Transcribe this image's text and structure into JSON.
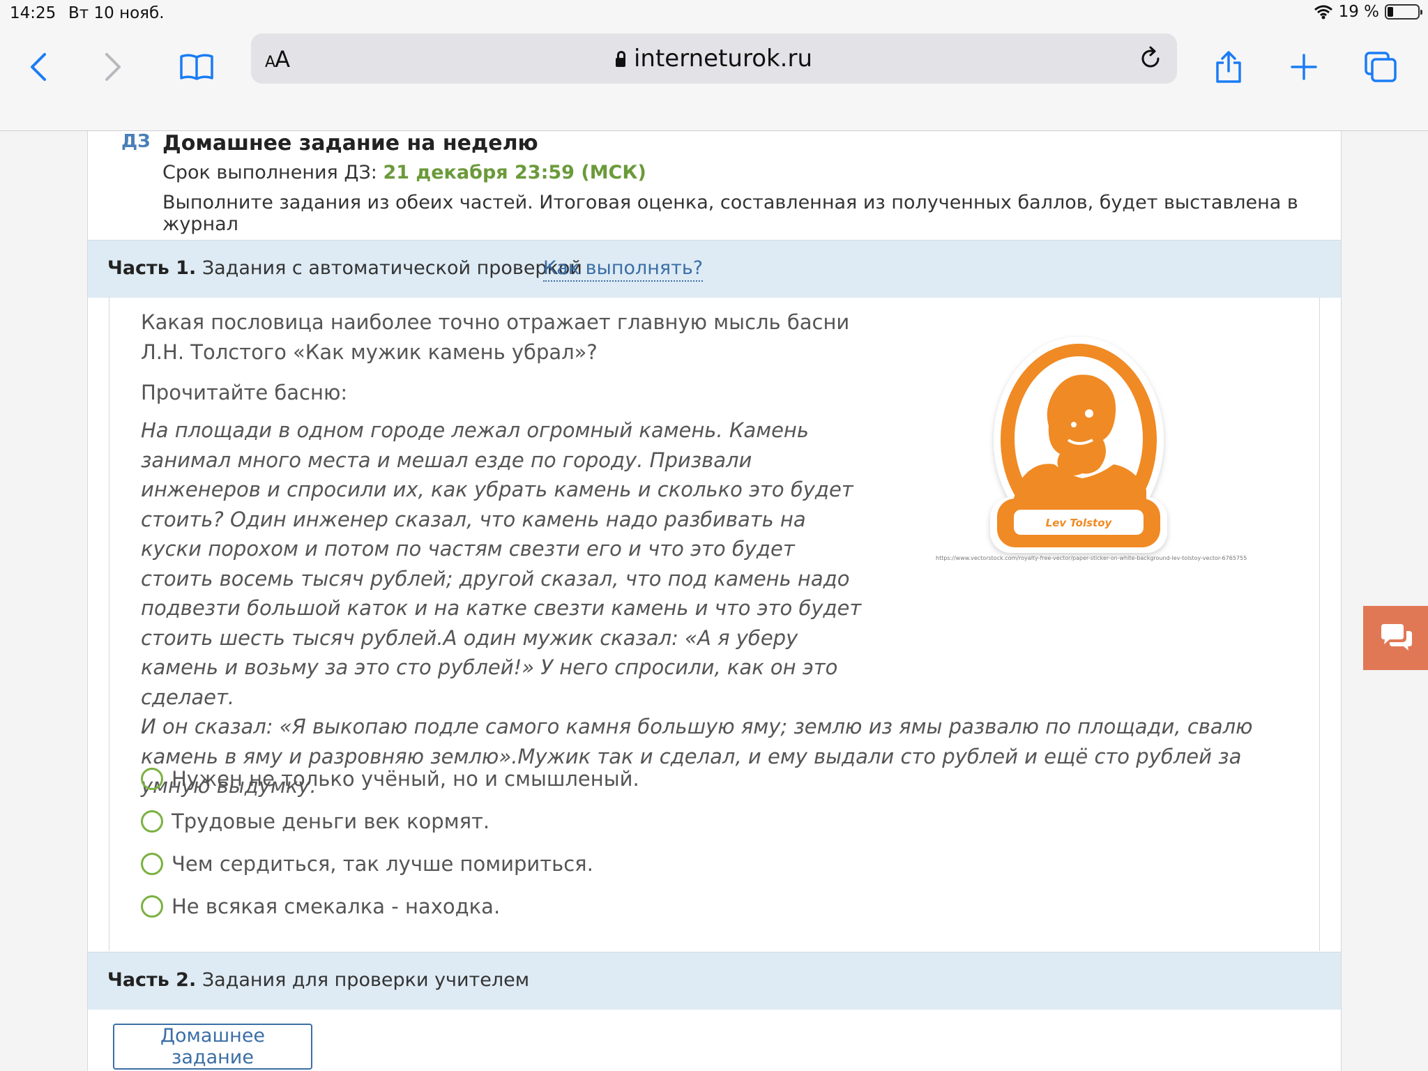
{
  "status_bar": {
    "time": "14:25",
    "date": "Вт 10 нояб.",
    "battery": "19 %",
    "battery_level": 0.19
  },
  "browser": {
    "text_size_button": "AA",
    "url": "interneturok.ru",
    "icons": [
      "back-icon",
      "forward-icon",
      "bookmarks-icon",
      "reload-icon",
      "share-icon",
      "new-tab-icon",
      "tabs-icon"
    ]
  },
  "homework": {
    "tag": "ДЗ",
    "title": "Домашнее задание на неделю",
    "deadline_label": "Срок выполнения ДЗ:",
    "deadline_value": "21 декабря 23:59 (МСК)",
    "description": "Выполните задания из обеих частей. Итоговая оценка, составленная из полученных баллов, будет выставлена в журнал"
  },
  "part1": {
    "label_bold": "Часть 1.",
    "label": "Задания с автоматической проверкой",
    "help_link": "Как выполнять?"
  },
  "task": {
    "question": "Какая пословица наиболее точно отражает главную мысль басни Л.Н. Толстого «Как мужик камень убрал»?",
    "prompt": "Прочитайте басню:",
    "fable_part1": "На площади в одном городе лежал огромный камень. Камень занимал много места и мешал езде по городу. Призвали инженеров и спросили их, как убрать камень и сколько это будет стоить? Один инженер сказал, что камень надо разбивать на куски порохом и потом по частям свезти его и что это будет стоить восемь тысяч рублей; другой сказал, что под камень надо подвезти большой каток и на катке свезти камень и что это будет стоить шесть тысяч рублей.А один мужик сказал: «А я уберу камень и возьму за это сто рублей!» У него спросили, как он это сделает.",
    "fable_part2": "И он сказал: «Я выкопаю подле самого камня большую яму; землю из ямы развалю по площади, свалю камень в яму и разровняю землю».Мужик так и сделал, и ему выдали сто рублей и ещё сто рублей за умную выдумку.",
    "image_label": "Lev Tolstoy",
    "image_caption": "https://www.vectorstock.com/royalty-free-vector/paper-sticker-on-white-background-lev-tolstoy-vector-6765755",
    "options": [
      "Нужен не только учёный, но и смышленый.",
      "Трудовые деньги век кормят.",
      "Чем сердиться, так лучше помириться.",
      "Не всякая смекалка - находка."
    ]
  },
  "part2": {
    "label_bold": "Часть 2.",
    "label": "Задания для проверки учителем"
  },
  "homework_button": "Домашнее задание",
  "colors": {
    "accent_blue": "#3a6ea5",
    "deadline_green": "#6b9a3a",
    "radio_green": "#7bb142",
    "part_bar": "#deebf4",
    "illustration_orange": "#f08a24",
    "chat_button": "#e17855"
  }
}
